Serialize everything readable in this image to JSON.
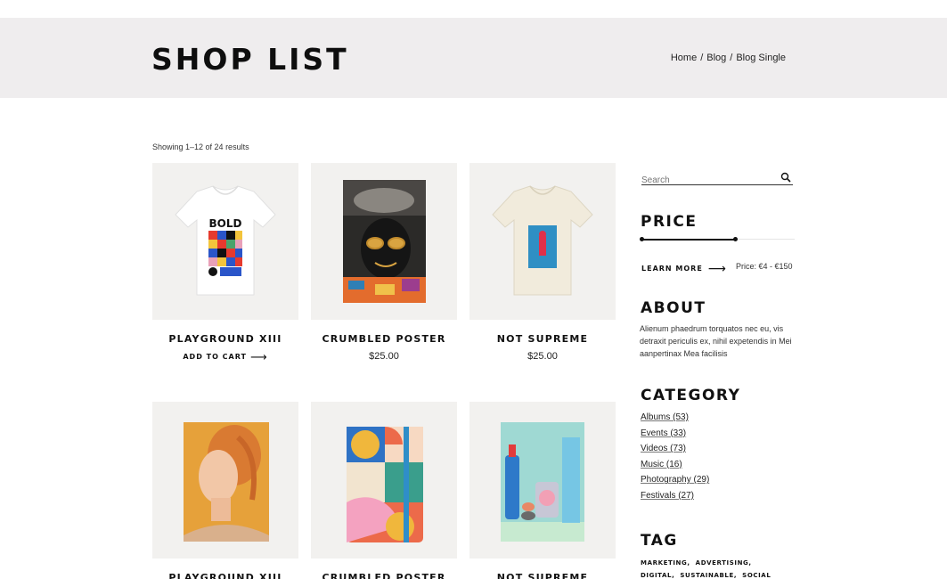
{
  "header": {
    "title": "SHOP LIST",
    "breadcrumb": [
      "Home",
      "Blog",
      "Blog Single"
    ]
  },
  "results_text": "Showing 1–12 of 24 results",
  "products": [
    {
      "name": "PLAYGROUND XIII",
      "action": "ADD TO CART",
      "image_text": "BOLD"
    },
    {
      "name": "CRUMBLED POSTER",
      "price": "$25.00"
    },
    {
      "name": "NOT SUPREME",
      "price": "$25.00"
    },
    {
      "name": "PLAYGROUND XIII"
    },
    {
      "name": "CRUMBLED POSTER"
    },
    {
      "name": "NOT SUPREME"
    }
  ],
  "sidebar": {
    "search": {
      "placeholder": "Search"
    },
    "price": {
      "heading": "PRICE",
      "learn_more": "LEARN MORE",
      "range_text": "Price: €4 - €150",
      "slider_fill_fraction": 0.61
    },
    "about": {
      "heading": "ABOUT",
      "text": "Alienum phaedrum torquatos nec eu, vis detraxit periculis ex, nihil expetendis in Mei aanpertinax Mea facilisis"
    },
    "category": {
      "heading": "CATEGORY",
      "items": [
        "Albums (53)",
        "Events  (33)",
        "Videos (73)",
        "Music (16)",
        "Photography (29)",
        "Festivals (27)"
      ]
    },
    "tag": {
      "heading": "TAG",
      "items": [
        "MARKETING,",
        "ADVERTISING,",
        "DIGITAL,",
        "SUSTAINABLE,",
        "SOCIAL"
      ]
    }
  },
  "icons": {
    "search": "search-icon",
    "arrow": "arrow-right-icon"
  },
  "colors": {
    "hero_bg": "#efedee",
    "thumb_bg": "#f2f1ef",
    "text": "#111111"
  }
}
